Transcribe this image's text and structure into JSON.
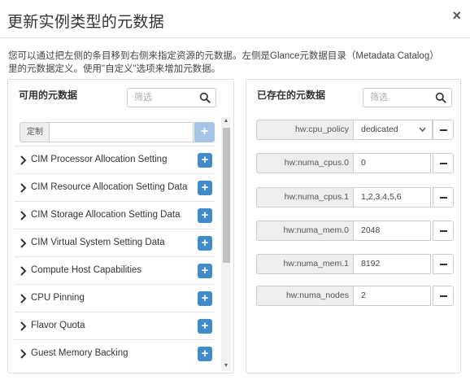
{
  "modal": {
    "title": "更新实例类型的元数据",
    "close_label": "×",
    "description": "您可以通过把左侧的条目移到右侧来指定资源的元数据。左侧是Glance元数据目录（Metadata Catalog）里的元数据定义。使用\"自定义\"选项来增加元数据。"
  },
  "available": {
    "title": "可用的元数据",
    "filter_placeholder": "筛选",
    "custom_label": "定制",
    "custom_value": "",
    "add_symbol": "+",
    "items": [
      {
        "label": "CIM Processor Allocation Setting"
      },
      {
        "label": "CIM Resource Allocation Setting Data"
      },
      {
        "label": "CIM Storage Allocation Setting Data"
      },
      {
        "label": "CIM Virtual System Setting Data"
      },
      {
        "label": "Compute Host Capabilities"
      },
      {
        "label": "CPU Pinning"
      },
      {
        "label": "Flavor Quota"
      },
      {
        "label": "Guest Memory Backing"
      }
    ],
    "scroll_up": "▲",
    "scroll_down": "▼"
  },
  "existing": {
    "title": "已存在的元数据",
    "filter_placeholder": "筛选",
    "rows": [
      {
        "key": "hw:cpu_policy",
        "value": "dedicated",
        "type": "select"
      },
      {
        "key": "hw:numa_cpus.0",
        "value": "0",
        "type": "text"
      },
      {
        "key": "hw:numa_cpus.1",
        "value": "1,2,3,4,5,6",
        "type": "text"
      },
      {
        "key": "hw:numa_mem.0",
        "value": "2048",
        "type": "text"
      },
      {
        "key": "hw:numa_mem.1",
        "value": "8192",
        "type": "text"
      },
      {
        "key": "hw:numa_nodes",
        "value": "2",
        "type": "text"
      }
    ]
  },
  "colors": {
    "primary": "#428bca",
    "primary_disabled": "#a6c4e6",
    "border": "#cccccc"
  }
}
